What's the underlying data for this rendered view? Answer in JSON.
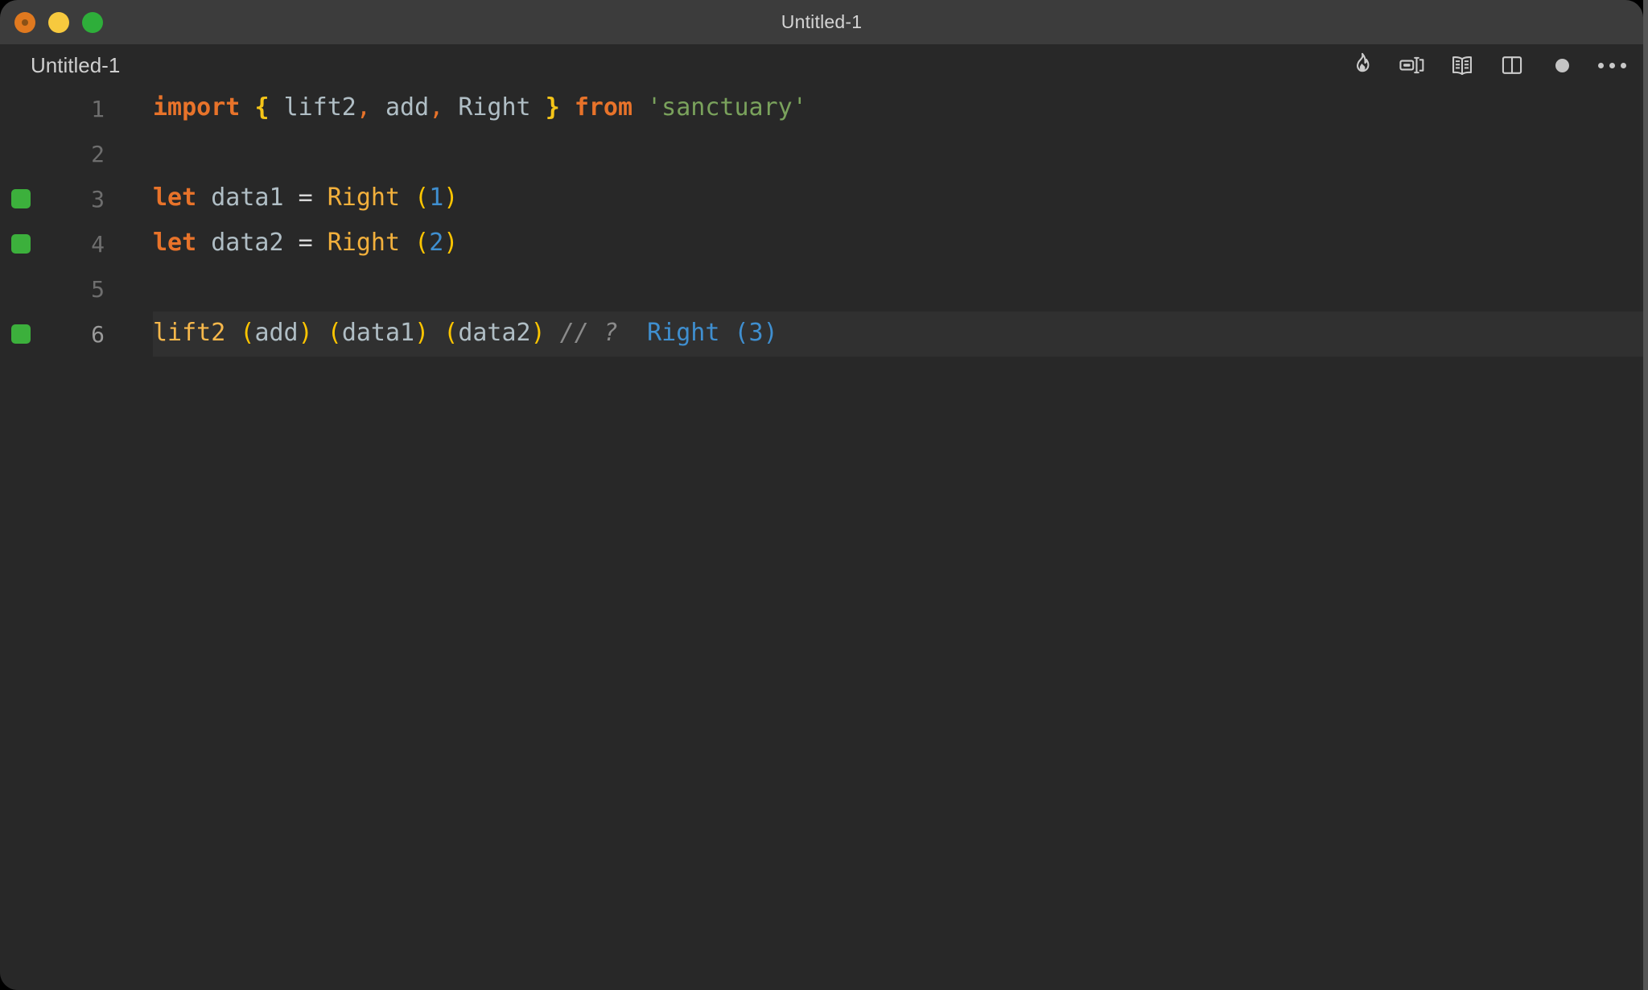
{
  "window": {
    "title": "Untitled-1",
    "traffic_lights": [
      {
        "name": "close",
        "color": "#e0791f"
      },
      {
        "name": "minimize",
        "color": "#f7c93e"
      },
      {
        "name": "maximize",
        "color": "#2eae3a"
      }
    ]
  },
  "tabbar": {
    "tab_label": "Untitled-1",
    "toolbar": [
      {
        "name": "run-flame-icon",
        "icon": "flame"
      },
      {
        "name": "toggle-inline-results-icon",
        "icon": "inline-values"
      },
      {
        "name": "open-preview-icon",
        "icon": "book"
      },
      {
        "name": "split-editor-icon",
        "icon": "split-pane"
      },
      {
        "name": "unsaved-changes-dot",
        "icon": "dot"
      },
      {
        "name": "more-actions-icon",
        "icon": "kebab"
      }
    ]
  },
  "editor": {
    "language": "javascript",
    "active_line": 6,
    "lines": [
      {
        "number": "1",
        "marker": false,
        "active": false,
        "tokens": [
          {
            "class": "t-keyword",
            "text": "import"
          },
          {
            "class": "t-op",
            "text": " "
          },
          {
            "class": "t-brace",
            "text": "{"
          },
          {
            "class": "t-op",
            "text": " "
          },
          {
            "class": "t-ident",
            "text": "lift2"
          },
          {
            "class": "t-punc",
            "text": ","
          },
          {
            "class": "t-op",
            "text": " "
          },
          {
            "class": "t-ident",
            "text": "add"
          },
          {
            "class": "t-punc",
            "text": ","
          },
          {
            "class": "t-op",
            "text": " "
          },
          {
            "class": "t-ident",
            "text": "Right"
          },
          {
            "class": "t-op",
            "text": " "
          },
          {
            "class": "t-brace",
            "text": "}"
          },
          {
            "class": "t-op",
            "text": " "
          },
          {
            "class": "t-keyword",
            "text": "from"
          },
          {
            "class": "t-op",
            "text": " "
          },
          {
            "class": "t-string",
            "text": "'sanctuary'"
          }
        ]
      },
      {
        "number": "2",
        "marker": false,
        "active": false,
        "tokens": []
      },
      {
        "number": "3",
        "marker": true,
        "active": false,
        "tokens": [
          {
            "class": "t-keyword",
            "text": "let"
          },
          {
            "class": "t-op",
            "text": " "
          },
          {
            "class": "t-ident",
            "text": "data1"
          },
          {
            "class": "t-op",
            "text": " = "
          },
          {
            "class": "t-type",
            "text": "Right"
          },
          {
            "class": "t-op",
            "text": " "
          },
          {
            "class": "t-paren",
            "text": "("
          },
          {
            "class": "t-number",
            "text": "1"
          },
          {
            "class": "t-paren",
            "text": ")"
          }
        ]
      },
      {
        "number": "4",
        "marker": true,
        "active": false,
        "tokens": [
          {
            "class": "t-keyword",
            "text": "let"
          },
          {
            "class": "t-op",
            "text": " "
          },
          {
            "class": "t-ident",
            "text": "data2"
          },
          {
            "class": "t-op",
            "text": " = "
          },
          {
            "class": "t-type",
            "text": "Right"
          },
          {
            "class": "t-op",
            "text": " "
          },
          {
            "class": "t-paren",
            "text": "("
          },
          {
            "class": "t-number",
            "text": "2"
          },
          {
            "class": "t-paren",
            "text": ")"
          }
        ]
      },
      {
        "number": "5",
        "marker": false,
        "active": false,
        "tokens": []
      },
      {
        "number": "6",
        "marker": true,
        "active": true,
        "tokens": [
          {
            "class": "t-func",
            "text": "lift2"
          },
          {
            "class": "t-op",
            "text": " "
          },
          {
            "class": "t-paren",
            "text": "("
          },
          {
            "class": "t-ident",
            "text": "add"
          },
          {
            "class": "t-paren",
            "text": ")"
          },
          {
            "class": "t-op",
            "text": " "
          },
          {
            "class": "t-paren",
            "text": "("
          },
          {
            "class": "t-ident",
            "text": "data1"
          },
          {
            "class": "t-paren",
            "text": ")"
          },
          {
            "class": "t-op",
            "text": " "
          },
          {
            "class": "t-paren",
            "text": "("
          },
          {
            "class": "t-ident",
            "text": "data2"
          },
          {
            "class": "t-paren",
            "text": ")"
          },
          {
            "class": "t-op",
            "text": " "
          },
          {
            "class": "t-comment",
            "text": "// ?"
          },
          {
            "class": "t-op",
            "text": "  "
          },
          {
            "class": "t-result",
            "text": "Right (3)"
          }
        ]
      }
    ]
  },
  "colors": {
    "window_background": "#282828",
    "titlebar_background": "#3c3c3c",
    "active_line_background": "#303030",
    "gutter_marker_green": "#3cb03c",
    "keyword_orange": "#e8732a",
    "string_green": "#7aa25c",
    "type_amber": "#f2b03c",
    "paren_yellow": "#fdc500",
    "number_blue": "#3f8fd0",
    "identifier_gray": "#b0bec5",
    "comment_gray": "#8a8a8a",
    "result_blue": "#3f8fd0",
    "line_number_gray": "#6e6e6e"
  }
}
